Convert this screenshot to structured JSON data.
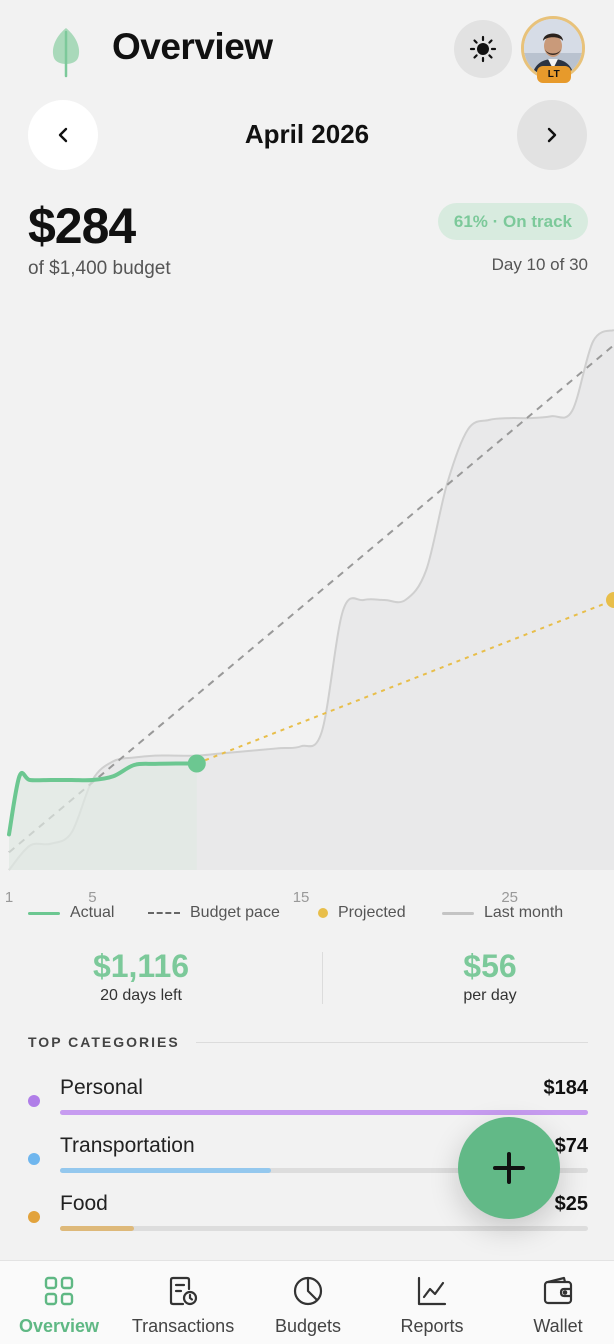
{
  "header": {
    "title": "Overview",
    "avatar_initials": "LT"
  },
  "month_nav": {
    "label": "April 2026"
  },
  "summary": {
    "spent": "$284",
    "budget_text": "of $1,400 budget",
    "status": "61% · On track",
    "day_text": "Day 10 of 30"
  },
  "chart_data": {
    "type": "line",
    "x_ticks": [
      "1",
      "5",
      "15",
      "25"
    ],
    "xlim": [
      1,
      30
    ],
    "ylim": [
      0,
      1400
    ],
    "series": [
      {
        "name": "Actual",
        "color": "#6cc791",
        "x": [
          1,
          1.5,
          2,
          3,
          4,
          5,
          6,
          7,
          8,
          9,
          10
        ],
        "y": [
          95,
          250,
          240,
          240,
          240,
          240,
          250,
          280,
          283,
          284,
          284
        ]
      },
      {
        "name": "Budget pace",
        "color": "#999999",
        "x": [
          1,
          30
        ],
        "y": [
          47,
          1400
        ]
      },
      {
        "name": "Projected",
        "color": "#e8be4a",
        "x": [
          10,
          30
        ],
        "y": [
          284,
          720
        ]
      },
      {
        "name": "Last month",
        "color": "#cfcfcf",
        "x": [
          1,
          2,
          3,
          4,
          5,
          6,
          7,
          8,
          9,
          10,
          11,
          12,
          13,
          14,
          15,
          16,
          17,
          18,
          19,
          20,
          21,
          22,
          23,
          24,
          25,
          26,
          27,
          28,
          29,
          30
        ],
        "y": [
          0,
          65,
          70,
          100,
          240,
          290,
          300,
          305,
          305,
          305,
          310,
          315,
          320,
          325,
          330,
          370,
          690,
          720,
          720,
          720,
          800,
          1030,
          1175,
          1200,
          1205,
          1205,
          1210,
          1225,
          1410,
          1440
        ]
      }
    ]
  },
  "legend": [
    {
      "label": "Actual"
    },
    {
      "label": "Budget pace"
    },
    {
      "label": "Projected"
    },
    {
      "label": "Last month"
    }
  ],
  "stats": {
    "remaining_value": "$1,116",
    "remaining_label": "20 days left",
    "per_day_value": "$56",
    "per_day_label": "per day"
  },
  "categories": {
    "heading": "TOP CATEGORIES",
    "items": [
      {
        "name": "Personal",
        "amount": "$184",
        "fraction": 1.0,
        "color": "#b07ee8",
        "bar_color": "#c79cf0"
      },
      {
        "name": "Transportation",
        "amount": "$74",
        "fraction": 0.4,
        "color": "#6fb6ee",
        "bar_color": "#94c8ee"
      },
      {
        "name": "Food",
        "amount": "$25",
        "fraction": 0.14,
        "color": "#e2a33d",
        "bar_color": "#deb97a"
      }
    ]
  },
  "fab": {
    "icon": "plus-icon"
  },
  "bottom_nav": [
    {
      "label": "Overview",
      "icon": "grid-icon",
      "active": true
    },
    {
      "label": "Transactions",
      "icon": "receipt-clock-icon",
      "active": false
    },
    {
      "label": "Budgets",
      "icon": "pie-chart-icon",
      "active": false
    },
    {
      "label": "Reports",
      "icon": "line-chart-icon",
      "active": false
    },
    {
      "label": "Wallet",
      "icon": "wallet-icon",
      "active": false
    }
  ]
}
